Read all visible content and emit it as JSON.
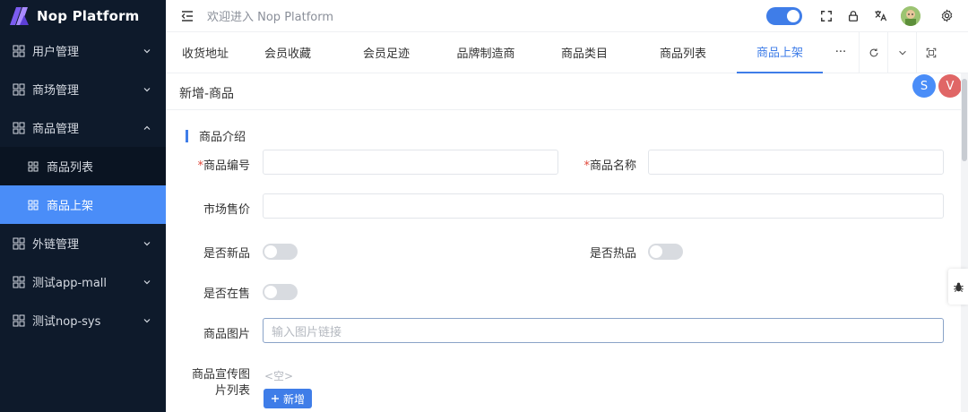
{
  "app": {
    "name": "Nop Platform",
    "welcome": "欢迎进入 Nop Platform"
  },
  "sidebar": {
    "items": [
      {
        "label": "用户管理"
      },
      {
        "label": "商场管理"
      },
      {
        "label": "商品管理"
      },
      {
        "label": "商品列表"
      },
      {
        "label": "商品上架"
      },
      {
        "label": "外链管理"
      },
      {
        "label": "测试app-mall"
      },
      {
        "label": "测试nop-sys"
      }
    ]
  },
  "tabs": [
    {
      "label": "收货地址"
    },
    {
      "label": "会员收藏"
    },
    {
      "label": "会员足迹"
    },
    {
      "label": "品牌制造商"
    },
    {
      "label": "商品类目"
    },
    {
      "label": "商品列表"
    },
    {
      "label": "商品上架"
    }
  ],
  "tabs_more": "···",
  "page": {
    "title": "新增-商品",
    "avatar_s": "S",
    "avatar_v": "V"
  },
  "form": {
    "section": "商品介绍",
    "goods_sn": {
      "label": "商品编号",
      "required_mark": "*",
      "value": ""
    },
    "name": {
      "label": "商品名称",
      "required_mark": "*",
      "value": ""
    },
    "counter_price": {
      "label": "市场售价",
      "value": ""
    },
    "is_new": {
      "label": "是否新品"
    },
    "is_hot": {
      "label": "是否热品"
    },
    "is_on_sale": {
      "label": "是否在售"
    },
    "pic_url": {
      "label": "商品图片",
      "placeholder": "输入图片链接"
    },
    "gallery": {
      "label_line1": "商品宣传图",
      "label_line2": "片列表",
      "empty": "<空>",
      "add": "新增"
    }
  },
  "colors": {
    "sidebar_bg": "#0e1a2b",
    "accent": "#3f7de8",
    "active_menu": "#4a8df8",
    "avatar_s": "#4a8df8",
    "avatar_v": "#e06666"
  }
}
